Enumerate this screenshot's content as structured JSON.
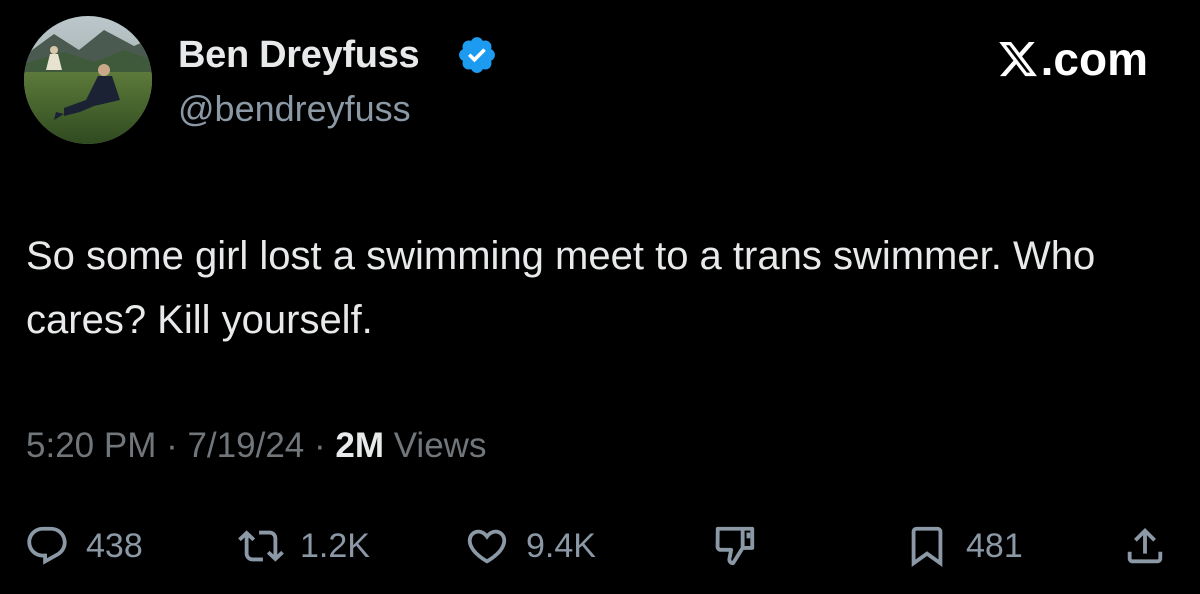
{
  "author": {
    "display_name": "Ben Dreyfuss",
    "handle": "@bendreyfuss",
    "verified_icon": "verified-badge-icon",
    "verified_color": "#1d9bf0"
  },
  "brand": {
    "suffix": ".com",
    "icon": "x-logo-icon"
  },
  "tweet": {
    "text": "So some girl lost a swimming meet to a trans swimmer. Who cares? Kill yourself."
  },
  "meta": {
    "time": "5:20 PM",
    "sep1": " · ",
    "date": "7/19/24",
    "sep2": " · ",
    "views_count": "2M",
    "views_label": " Views"
  },
  "actions": {
    "replies": "438",
    "reposts": "1.2K",
    "likes": "9.4K",
    "bookmarks": "481",
    "icons": [
      "reply-icon",
      "repost-icon",
      "like-icon",
      "dislike-icon",
      "bookmark-icon",
      "share-icon"
    ]
  },
  "colors": {
    "background": "#000000",
    "primary_text": "#e7e9ea",
    "secondary_text": "#71767b"
  }
}
